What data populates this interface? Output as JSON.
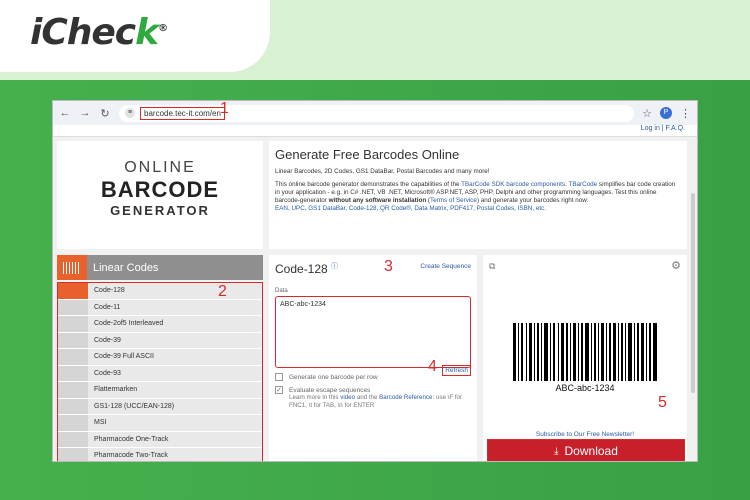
{
  "brand": {
    "logo_main": "iChec",
    "logo_k": "k",
    "logo_mark": "®"
  },
  "browser": {
    "url": "barcode.tec-it.com/en",
    "avatar": "P",
    "login": "Log in | F.A.Q."
  },
  "annotations": {
    "a1": "1",
    "a2": "2",
    "a3": "3",
    "a4": "4",
    "a5": "5"
  },
  "hero": {
    "logo_line1": "ONLINE",
    "logo_line2": "BARCODE",
    "logo_line3": "GENERATOR",
    "title": "Generate Free Barcodes Online",
    "subtitle": "Linear Barcodes, 2D Codes, GS1 DataBar, Postal Barcodes and many more!",
    "desc_1": "This online barcode generator demonstrates the capabilities of the ",
    "desc_link1": "TBarCode SDK  barcode components",
    "desc_2": ". ",
    "desc_link2": "TBarCode",
    "desc_3": " simplifies bar code creation in your application - e.g. in C# .NET, VB .NET, Microsoft® ASP.NET, ASP, PHP, Delphi and other programming languages. Test this online barcode-generator ",
    "desc_bold": "without any software installation",
    "desc_4": " (",
    "desc_link3": "Terms of Service",
    "desc_5": ") and generate your barcodes right now:",
    "links_line": "EAN, UPC, GS1 DataBar, Code-128, QR Code®, Data Matrix, PDF417, Postal Codes, ISBN, etc."
  },
  "sidebar": {
    "heading": "Linear Codes",
    "items": [
      {
        "label": "Code-128"
      },
      {
        "label": "Code-11"
      },
      {
        "label": "Code-2of5 Interleaved"
      },
      {
        "label": "Code-39"
      },
      {
        "label": "Code-39 Full ASCII"
      },
      {
        "label": "Code-93"
      },
      {
        "label": "Flattermarken"
      },
      {
        "label": "GS1-128 (UCC/EAN-128)"
      },
      {
        "label": "MSI"
      },
      {
        "label": "Pharmacode One-Track"
      },
      {
        "label": "Pharmacode Two-Track"
      }
    ]
  },
  "form": {
    "title": "Code-128",
    "info_icon": "info-icon",
    "create_sequence": "Create Sequence",
    "data_label": "Data",
    "data_value": "ABC-abc-1234",
    "opt1": "Generate one barcode per row",
    "opt2": "Evaluate escape sequences",
    "opt2_checked": "✓",
    "hint_1": "Learn more in this ",
    "hint_link1": "video",
    "hint_2": " and the ",
    "hint_link2": "Barcode Reference",
    "hint_3": ": use \\F for FNC1, \\t for TAB, \\n for ENTER",
    "refresh": "Refresh"
  },
  "preview": {
    "barcode_text": "ABC-abc-1234",
    "newsletter": "Subscribe to Our Free Newsletter!",
    "download": "Download",
    "copy_icon": "⧉",
    "gear_icon": "⚙",
    "download_icon": "⤓"
  }
}
